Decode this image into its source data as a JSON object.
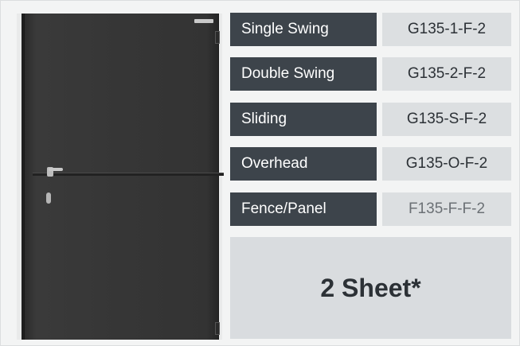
{
  "door_image": {
    "description_icon": "steel-door-icon"
  },
  "rows": [
    {
      "type": "Single Swing",
      "code": "G135-1-F-2"
    },
    {
      "type": "Double Swing",
      "code": "G135-2-F-2"
    },
    {
      "type": "Sliding",
      "code": "G135-S-F-2"
    },
    {
      "type": "Overhead",
      "code": "G135-O-F-2"
    },
    {
      "type": "Fence/Panel",
      "code": "F135-F-F-2"
    }
  ],
  "sheet_label": "2 Sheet*",
  "colors": {
    "type_bg": "#3d444b",
    "code_bg": "#dcdfe1",
    "sheet_bg": "#d9dcdf",
    "page_bg": "#f3f4f4"
  }
}
